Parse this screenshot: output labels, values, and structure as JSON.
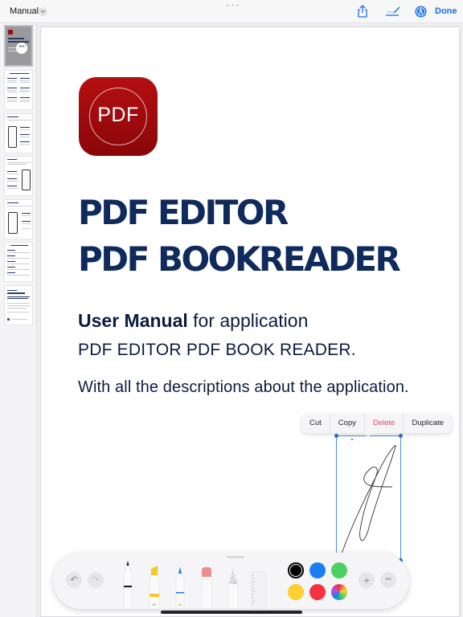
{
  "topbar": {
    "title": "Manual",
    "done_label": "Done",
    "icons": [
      "chevron-down-icon",
      "share-icon",
      "signature-icon",
      "markup-icon"
    ]
  },
  "sidebar": {
    "thumbnails": [
      {
        "page": 1,
        "selected": true
      },
      {
        "page": 2,
        "selected": false
      },
      {
        "page": 3,
        "selected": false
      },
      {
        "page": 4,
        "selected": false
      },
      {
        "page": 5,
        "selected": false
      },
      {
        "page": 6,
        "selected": false
      },
      {
        "page": 7,
        "selected": false
      }
    ],
    "more_label": "•••"
  },
  "document": {
    "app_icon_text": "PDF",
    "heading_line1": "PDF EDITOR",
    "heading_line2": "PDF BOOKREADER",
    "subtitle_bold": "User Manual",
    "subtitle_rest": " for application",
    "subtitle_line2": "PDF EDITOR PDF BOOK READER.",
    "description": "With all the descriptions about the application."
  },
  "context_menu": {
    "items": [
      "Cut",
      "Copy",
      "Delete",
      "Duplicate"
    ]
  },
  "palette": {
    "undo_icon": "↶",
    "redo_icon": "↷",
    "tools": [
      "pen",
      "highlighter",
      "marker",
      "eraser",
      "lasso",
      "ruler"
    ],
    "highlighter_size": "80",
    "marker_size": "50",
    "colors": {
      "black": "#000000",
      "blue": "#1a7ef2",
      "green": "#4cd160",
      "yellow": "#fdd12f",
      "red": "#f5323f"
    },
    "selected_color": "black",
    "add_label": "+",
    "more_label": "•••"
  }
}
